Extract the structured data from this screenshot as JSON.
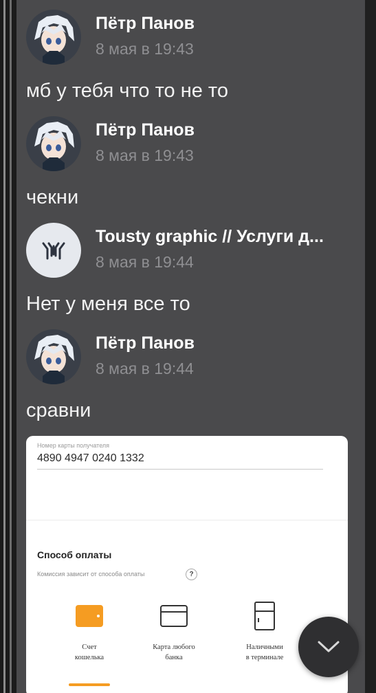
{
  "messages": [
    {
      "author": "Пётр Панов",
      "time": "8 мая в 19:43",
      "text": "мб у тебя что то не то",
      "avatar": "anime-avatar"
    },
    {
      "author": "Пётр Панов",
      "time": "8 мая в 19:43",
      "text": "чекни",
      "avatar": "anime-avatar"
    },
    {
      "author": "Tousty graphic // Услуги д...",
      "time": "8 мая в 19:44",
      "text": "Нет у меня все то",
      "avatar": "logo-avatar"
    },
    {
      "author": "Пётр Панов",
      "time": "8 мая в 19:44",
      "text": "сравни",
      "avatar": "anime-avatar"
    }
  ],
  "attachment": {
    "card_label": "Номер карты получателя",
    "card_number": "4890 4947 0240 1332",
    "payment_title": "Способ оплаты",
    "payment_subtitle": "Комиссия зависит от способа оплаты",
    "help_icon": "?",
    "options": [
      {
        "label": "Счет\nкошелька",
        "icon": "wallet-icon",
        "selected": true
      },
      {
        "label": "Карта любого\nбанка",
        "icon": "card-icon",
        "selected": false
      },
      {
        "label": "Наличными\nв терминале",
        "icon": "terminal-icon",
        "selected": false
      }
    ]
  },
  "scroll_button": {
    "icon": "chevron-down-icon"
  },
  "colors": {
    "chat_bg": "#4a4a4c",
    "author": "#ffffff",
    "time": "#8f8f92",
    "accent_orange": "#f59c22"
  }
}
